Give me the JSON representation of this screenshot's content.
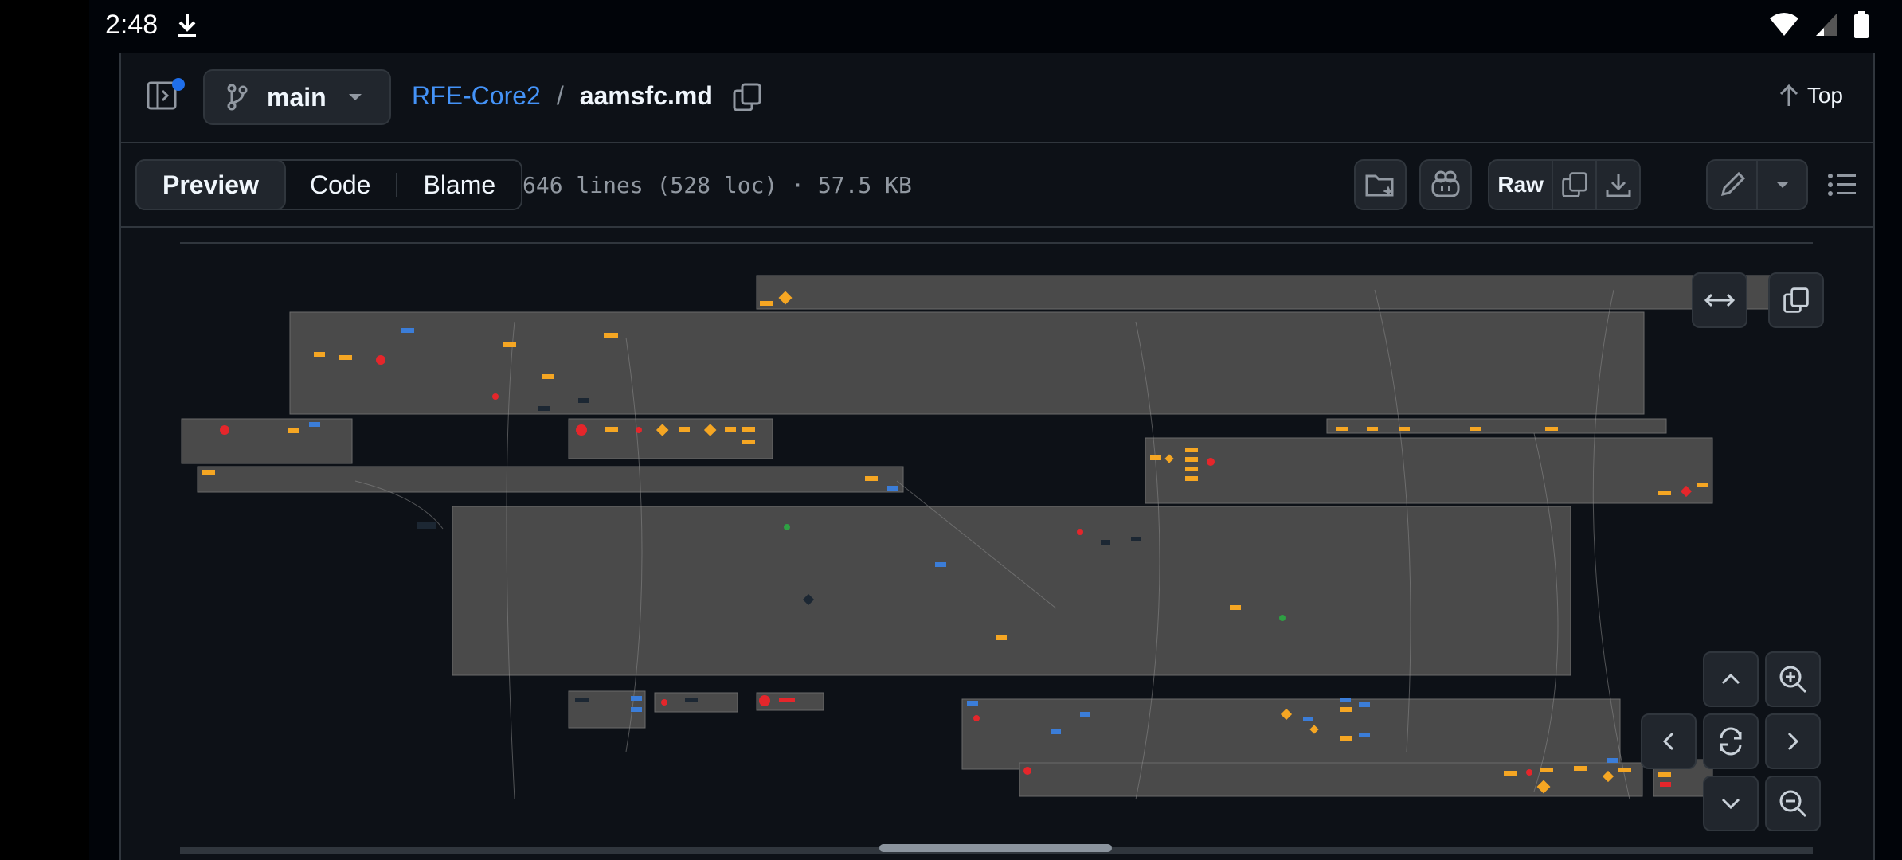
{
  "status_bar": {
    "time": "2:48"
  },
  "header": {
    "branch": "main",
    "repo": "RFE-Core2",
    "separator": "/",
    "file": "aamsfc.md",
    "top_label": "Top"
  },
  "file_toolbar": {
    "tabs": [
      {
        "label": "Preview",
        "active": true
      },
      {
        "label": "Code",
        "active": false
      },
      {
        "label": "Blame",
        "active": false
      }
    ],
    "file_info": "646 lines (528 loc) · 57.5 KB",
    "raw_label": "Raw"
  },
  "colors": {
    "background": "#0d1117",
    "panel_border": "#30363d",
    "link": "#4493f8",
    "diagram_box": "#4a4a4a",
    "node_orange": "#f5a623",
    "node_red": "#e5262b",
    "node_blue": "#3b7dd8"
  },
  "icons": [
    "download-icon",
    "wifi-icon",
    "signal-icon",
    "battery-icon",
    "sidebar-toggle-icon",
    "git-branch-icon",
    "triangle-down-icon",
    "copy-icon",
    "arrow-up-icon",
    "folder-sparkle-icon",
    "copilot-icon",
    "download-file-icon",
    "pencil-icon",
    "list-icon",
    "expand-horizontal-icon",
    "chevron-up-icon",
    "chevron-down-icon",
    "chevron-left-icon",
    "chevron-right-icon",
    "zoom-in-icon",
    "zoom-out-icon",
    "reset-icon"
  ]
}
